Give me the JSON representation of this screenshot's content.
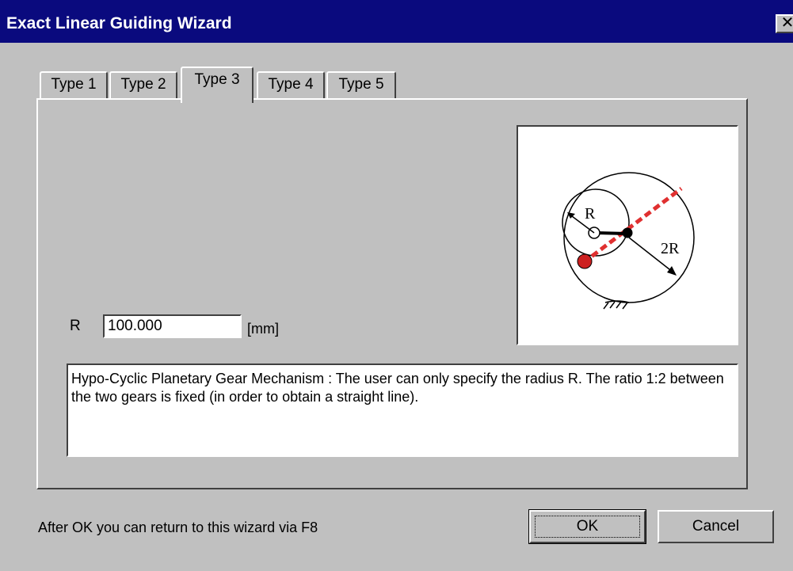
{
  "window": {
    "title": "Exact Linear Guiding Wizard",
    "close_label": "✕"
  },
  "tabs": [
    {
      "label": "Type 1",
      "active": false
    },
    {
      "label": "Type 2",
      "active": false
    },
    {
      "label": "Type 3",
      "active": true
    },
    {
      "label": "Type 4",
      "active": false
    },
    {
      "label": "Type 5",
      "active": false
    }
  ],
  "form": {
    "r_label": "R",
    "r_value": "100.000",
    "unit": "[mm]",
    "description": "Hypo-Cyclic Planetary Gear Mechanism : The user can only specify the radius R. The ratio 1:2 between the two gears is fixed (in order to obtain a straight line)."
  },
  "diagram": {
    "small_radius_label": "R",
    "large_radius_label": "2R",
    "line_color": "#e03030",
    "dot_color": "#cc2020"
  },
  "footer": {
    "hint": "After OK you can return to this wizard via F8",
    "ok_label": "OK",
    "cancel_label": "Cancel"
  }
}
